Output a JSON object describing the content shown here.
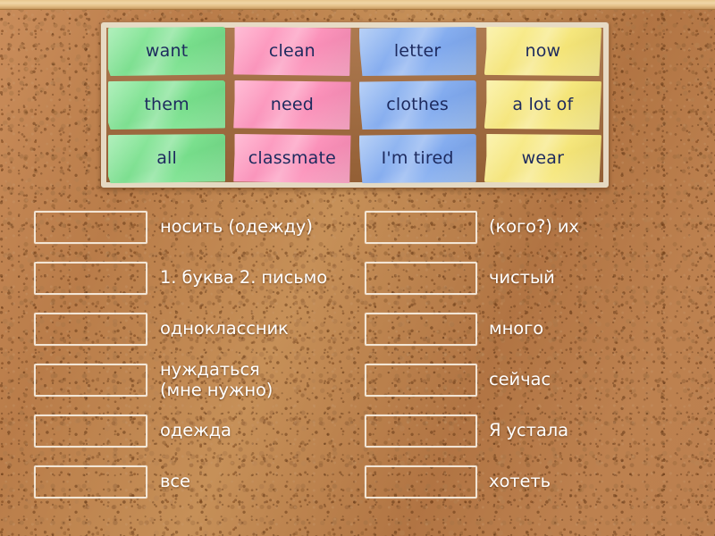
{
  "activity": {
    "type": "match-up",
    "background": "cork-board",
    "colors": {
      "board": "#bb8050",
      "frame": "#f0d6a6",
      "tile_green": "#8ae89b",
      "tile_pink": "#ff9ec2",
      "tile_blue": "#95baf2",
      "tile_yellow": "#f9ed8c",
      "tile_text": "#1d2a5e",
      "label_text": "#ffffff",
      "slot_border": "#faf4e8"
    }
  },
  "word_tray": {
    "rows": [
      [
        {
          "label": "want",
          "color": "green"
        },
        {
          "label": "clean",
          "color": "pink"
        },
        {
          "label": "letter",
          "color": "blue"
        },
        {
          "label": "now",
          "color": "yellow"
        }
      ],
      [
        {
          "label": "them",
          "color": "green"
        },
        {
          "label": "need",
          "color": "pink"
        },
        {
          "label": "clothes",
          "color": "blue"
        },
        {
          "label": "a lot of",
          "color": "yellow"
        }
      ],
      [
        {
          "label": "all",
          "color": "green"
        },
        {
          "label": "classmate",
          "color": "pink"
        },
        {
          "label": "I'm tired",
          "color": "blue"
        },
        {
          "label": "wear",
          "color": "yellow"
        }
      ]
    ]
  },
  "answers": {
    "left_column": [
      {
        "slot_value": "",
        "label": "носить (одежду)"
      },
      {
        "slot_value": "",
        "label": "1. буква 2. письмо"
      },
      {
        "slot_value": "",
        "label": "одноклассник"
      },
      {
        "slot_value": "",
        "label": "нуждаться\n(мне нужно)"
      },
      {
        "slot_value": "",
        "label": "одежда"
      },
      {
        "slot_value": "",
        "label": "все"
      }
    ],
    "right_column": [
      {
        "slot_value": "",
        "label": "(кого?) их"
      },
      {
        "slot_value": "",
        "label": "чистый"
      },
      {
        "slot_value": "",
        "label": "много"
      },
      {
        "slot_value": "",
        "label": "сейчас"
      },
      {
        "slot_value": "",
        "label": "Я устала"
      },
      {
        "slot_value": "",
        "label": "хотеть"
      }
    ]
  }
}
